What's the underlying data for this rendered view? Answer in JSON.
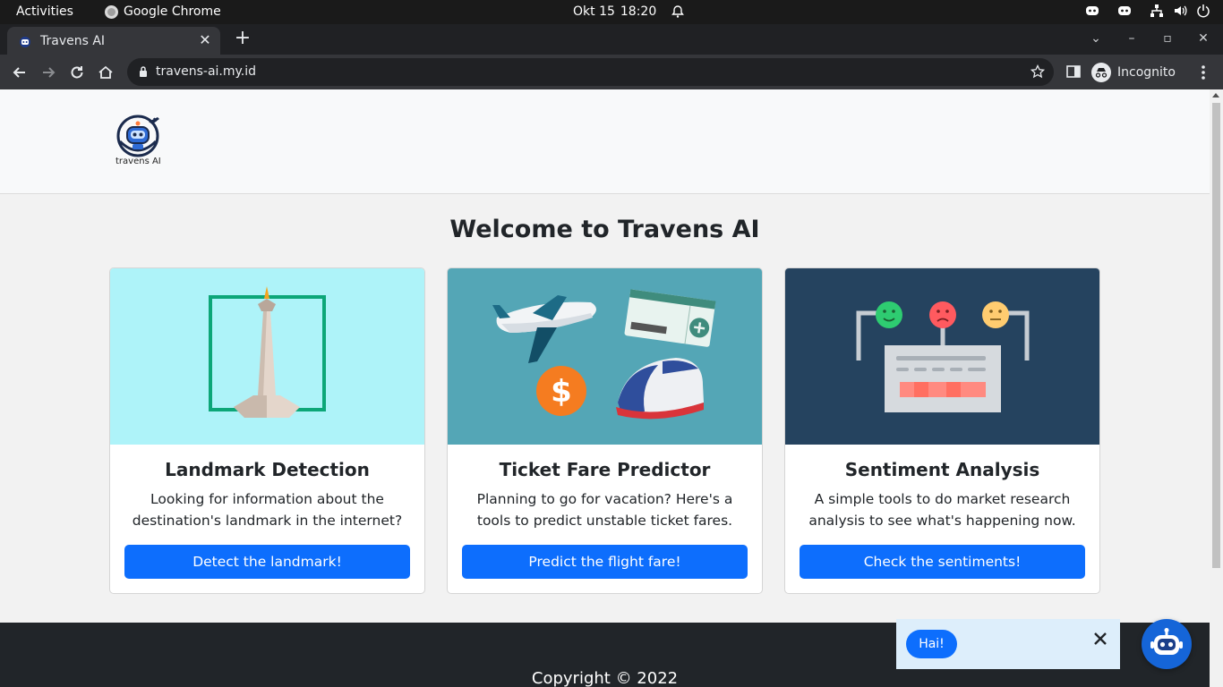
{
  "os_bar": {
    "activities": "Activities",
    "app_name": "Google Chrome",
    "date": "Okt 15",
    "time": "18:20"
  },
  "browser": {
    "tab_title": "Travens AI",
    "url": "travens-ai.my.id",
    "profile_label": "Incognito"
  },
  "site": {
    "logo_text": "travens AI",
    "welcome": "Welcome to Travens AI",
    "cards": [
      {
        "title": "Landmark Detection",
        "desc": "Looking for information about the destination's landmark in the internet?",
        "button": "Detect the landmark!",
        "art_bg": "#aef3f9"
      },
      {
        "title": "Ticket Fare Predictor",
        "desc": "Planning to go for vacation? Here's a tools to predict unstable ticket fares.",
        "button": "Predict the flight fare!",
        "art_bg": "#54a6b6"
      },
      {
        "title": "Sentiment Analysis",
        "desc": "A simple tools to do market research analysis to see what's happening now.",
        "button": "Check the sentiments!",
        "art_bg": "#25435f"
      }
    ],
    "footer": "Copyright © 2022",
    "chat": {
      "greeting": "Hai!"
    },
    "colors": {
      "primary": "#0d6efd",
      "footer_bg": "#212529"
    }
  }
}
